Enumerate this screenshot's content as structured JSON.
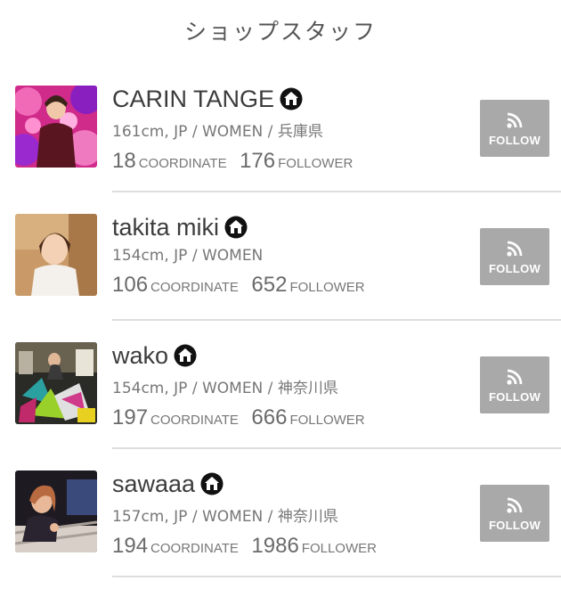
{
  "page": {
    "title": "ショップスタッフ"
  },
  "staff": [
    {
      "name": "CARIN TANGE",
      "profile": "161cm, JP / WOMEN / 兵庫県",
      "coordinate_count": "18",
      "coordinate_label": "COORDINATE",
      "follower_count": "176",
      "follower_label": "FOLLOWER",
      "follow_label": "FOLLOW",
      "shop_icon": "shop-house-icon",
      "follow_icon": "rss-icon"
    },
    {
      "name": "takita miki",
      "profile": "154cm, JP / WOMEN",
      "coordinate_count": "106",
      "coordinate_label": "COORDINATE",
      "follower_count": "652",
      "follower_label": "FOLLOWER",
      "follow_label": "FOLLOW",
      "shop_icon": "shop-house-icon",
      "follow_icon": "rss-icon"
    },
    {
      "name": "wako",
      "profile": "154cm, JP / WOMEN / 神奈川県",
      "coordinate_count": "197",
      "coordinate_label": "COORDINATE",
      "follower_count": "666",
      "follower_label": "FOLLOWER",
      "follow_label": "FOLLOW",
      "shop_icon": "shop-house-icon",
      "follow_icon": "rss-icon"
    },
    {
      "name": "sawaaa",
      "profile": "157cm, JP / WOMEN / 神奈川県",
      "coordinate_count": "194",
      "coordinate_label": "COORDINATE",
      "follower_count": "1986",
      "follower_label": "FOLLOWER",
      "follow_label": "FOLLOW",
      "shop_icon": "shop-house-icon",
      "follow_icon": "rss-icon"
    }
  ],
  "colors": {
    "follow_button_bg": "#a9a9a9",
    "divider": "#dddddd",
    "text_primary": "#3c3c3c",
    "text_secondary": "#777777"
  }
}
